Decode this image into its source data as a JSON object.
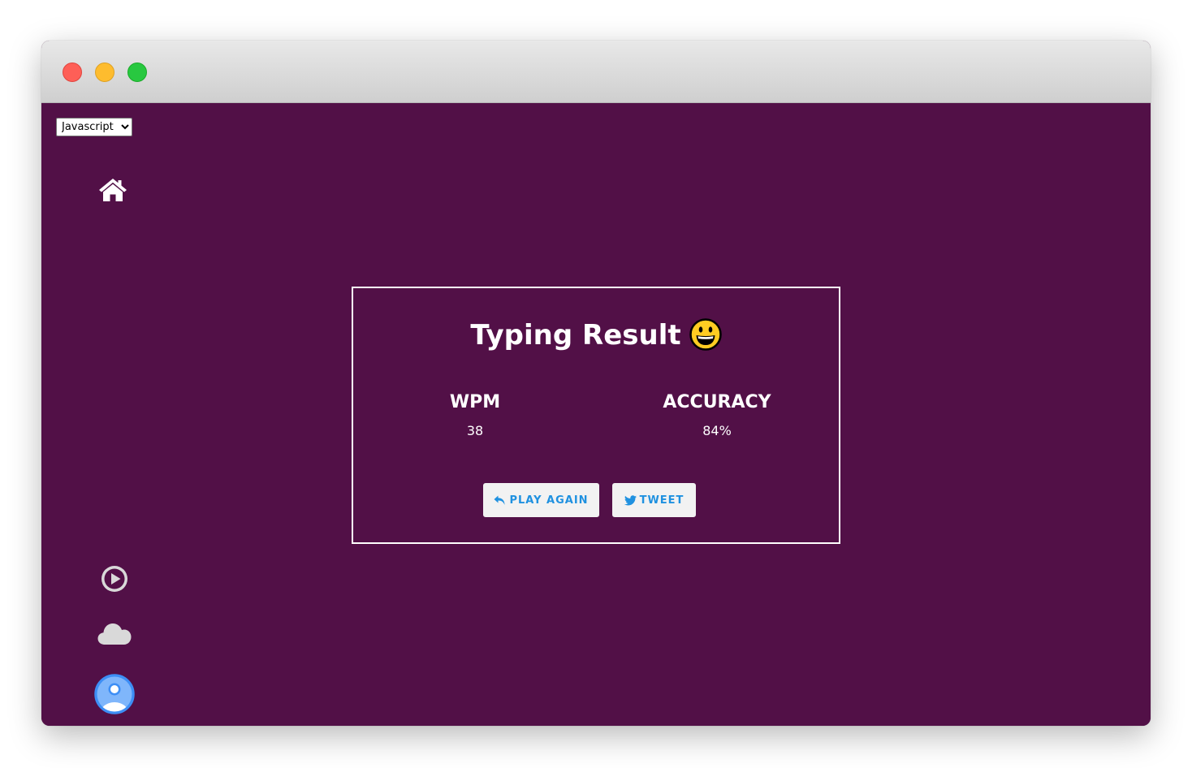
{
  "window": {
    "controls": [
      "close",
      "minimize",
      "maximize"
    ]
  },
  "language_select": {
    "selected": "Javascript",
    "options": [
      "Javascript"
    ]
  },
  "sidebar": {
    "top_icons": [
      "home-icon"
    ],
    "bottom_icons": [
      "play-icon",
      "cloud-icon",
      "profile-icon"
    ]
  },
  "result": {
    "title": "Typing Result",
    "emoji_icon": "grinning-face-icon",
    "wpm": {
      "label": "WPM",
      "value": "38"
    },
    "accuracy": {
      "label": "ACCURACY",
      "value": "84%"
    },
    "play_again_label": "PLAY AGAIN",
    "tweet_label": "TWEET"
  },
  "colors": {
    "background": "#521047",
    "text": "#ffffff",
    "button_bg": "#f2f2f2",
    "button_text": "#1f91e0",
    "profile_blue": "#3d8ef5"
  }
}
